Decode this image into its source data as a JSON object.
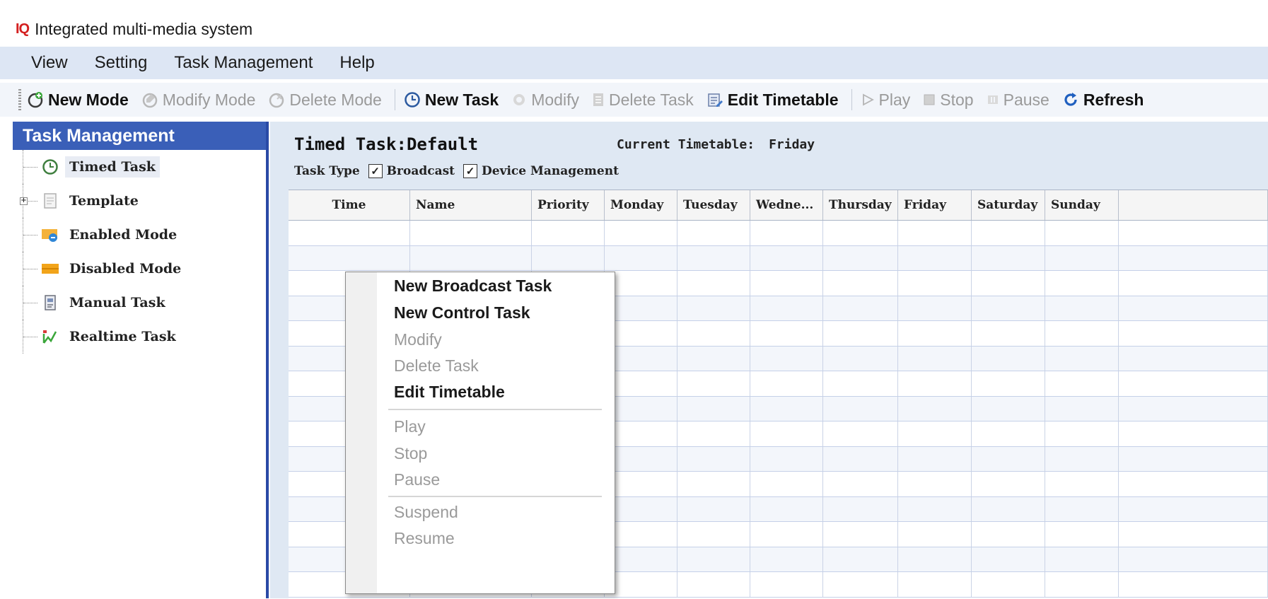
{
  "window": {
    "logo": "IQ",
    "title": "Integrated multi-media system"
  },
  "menubar": [
    "View",
    "Setting",
    "Task Management",
    "Help"
  ],
  "toolbar": [
    {
      "label": "New Mode",
      "enabled": true,
      "icon": "new-mode-icon"
    },
    {
      "label": "Modify Mode",
      "enabled": false,
      "icon": "modify-mode-icon"
    },
    {
      "label": "Delete Mode",
      "enabled": false,
      "icon": "delete-mode-icon"
    },
    {
      "label": "New Task",
      "enabled": true,
      "icon": "new-task-icon"
    },
    {
      "label": "Modify",
      "enabled": false,
      "icon": "modify-icon"
    },
    {
      "label": "Delete Task",
      "enabled": false,
      "icon": "delete-task-icon"
    },
    {
      "label": "Edit Timetable",
      "enabled": true,
      "icon": "edit-timetable-icon"
    },
    {
      "label": "Play",
      "enabled": false,
      "icon": "play-icon"
    },
    {
      "label": "Stop",
      "enabled": false,
      "icon": "stop-icon"
    },
    {
      "label": "Pause",
      "enabled": false,
      "icon": "pause-icon"
    },
    {
      "label": "Refresh",
      "enabled": true,
      "icon": "refresh-icon"
    }
  ],
  "sidebar": {
    "title": "Task Management",
    "items": [
      {
        "label": "Timed Task",
        "icon": "clock-icon",
        "selected": true
      },
      {
        "label": "Template",
        "icon": "template-icon",
        "expandable": true
      },
      {
        "label": "Enabled Mode",
        "icon": "enabled-mode-icon"
      },
      {
        "label": "Disabled Mode",
        "icon": "disabled-mode-icon"
      },
      {
        "label": "Manual Task",
        "icon": "manual-task-icon"
      },
      {
        "label": "Realtime Task",
        "icon": "realtime-task-icon"
      }
    ]
  },
  "main": {
    "task_title": "Timed Task:Default",
    "timetable_label": "Current Timetable:",
    "timetable_value": "Friday",
    "task_type_label": "Task Type",
    "task_types": [
      {
        "label": "Broadcast",
        "checked": true
      },
      {
        "label": "Device Management",
        "checked": true
      }
    ],
    "columns": [
      "Time",
      "Name",
      "Priority",
      "Monday",
      "Tuesday",
      "Wedne...",
      "Thursday",
      "Friday",
      "Saturday",
      "Sunday",
      ""
    ]
  },
  "context_menu": [
    {
      "label": "New Broadcast Task",
      "enabled": true
    },
    {
      "label": "New Control Task",
      "enabled": true
    },
    {
      "label": "Modify",
      "enabled": false
    },
    {
      "label": "Delete Task",
      "enabled": false
    },
    {
      "label": "Edit Timetable",
      "enabled": true
    },
    {
      "separator": true
    },
    {
      "label": "Play",
      "enabled": false
    },
    {
      "label": "Stop",
      "enabled": false
    },
    {
      "label": "Pause",
      "enabled": false
    },
    {
      "separator": true
    },
    {
      "label": "Suspend",
      "enabled": false
    },
    {
      "label": "Resume",
      "enabled": false
    }
  ]
}
